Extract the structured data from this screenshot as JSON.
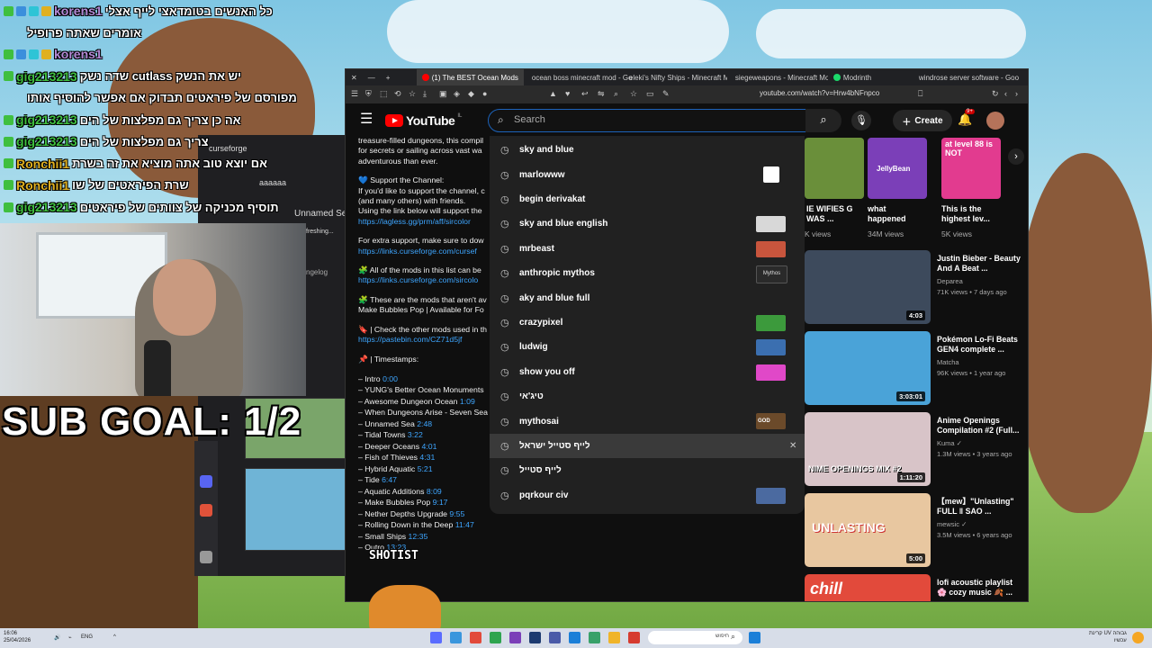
{
  "chat": [
    {
      "user": "korens1",
      "user_color": "#b48ad6",
      "msg": "כל האנשים בטומדאצי לייף אצלי"
    },
    {
      "user": "",
      "user_color": "",
      "msg": "אומרים שאתה פרופיל",
      "cont": true
    },
    {
      "user": "korens1",
      "user_color": "#b48ad6",
      "msg": ""
    },
    {
      "user": "gig213213",
      "user_color": "#3fbf3f",
      "msg": "שדה נשק cutlass יש את הנשק"
    },
    {
      "user": "",
      "user_color": "",
      "msg": "מפורסם של פיראטים תבדוק אם אפשר להוסיף אותו",
      "cont": true
    },
    {
      "user": "gig213213",
      "user_color": "#3fbf3f",
      "msg": "אה כן צריך גם מפלצות של הים"
    },
    {
      "user": "gig213213",
      "user_color": "#3fbf3f",
      "msg": "צריך גם מפלצות של הים"
    },
    {
      "user": "Ronchii1",
      "user_color": "#e0b020",
      "msg": "אם יוצא טוב אתה מוציא את זה בשרת"
    },
    {
      "user": "Ronchii1",
      "user_color": "#e0b020",
      "msg": "שרת הפיראטים של שו"
    },
    {
      "user": "gig213213",
      "user_color": "#3fbf3f",
      "msg": "תוסיף מכניקה של צוותים של פיראטים"
    }
  ],
  "overlay": {
    "sub_goal": "SUB GOAL: 1/2",
    "shotist": "SHOTIST"
  },
  "curseforge": {
    "title": "curseforge",
    "item1": "aaaaaa",
    "unnamed": "Unnamed Sea",
    "refreshing": "freshing...",
    "changelog": "ngelog"
  },
  "browser": {
    "tabs": [
      {
        "label": "(1) The BEST Ocean Mods",
        "active": true,
        "color": "#ff0000"
      },
      {
        "label": "ocean boss minecraft mod - Go",
        "active": false,
        "color": "#4285f4"
      },
      {
        "label": "eleki's Nifty Ships - Minecraft M",
        "active": false,
        "color": "#f16436"
      },
      {
        "label": "siegeweapons - Minecraft Mod",
        "active": false,
        "color": "#f16436"
      },
      {
        "label": "Modrinth",
        "active": false,
        "color": "#1bd96a"
      },
      {
        "label": "windrose server software - Goo",
        "active": false,
        "color": "#4285f4"
      }
    ],
    "url": "youtube.com/watch?v=Hrw4bNFnpco"
  },
  "youtube": {
    "logo": "YouTube",
    "country": "IL",
    "search_placeholder": "Search",
    "create_label": "Create",
    "notif_count": "9+"
  },
  "description": {
    "intro_1": "treasure-filled dungeons, this compil",
    "intro_2": "for secrets or sailing across vast wa",
    "intro_3": "adventurous than ever.",
    "support_head": "💙 Support the Channel:",
    "support_1": "If you'd like to support the channel, c",
    "support_2": "(and many others) with friends.",
    "support_3": "Using the link below will support the",
    "support_link": "https://lagless.gg/prm/aff/sircolor",
    "extra": "For extra support, make sure to dow",
    "extra_link": "https://links.curseforge.com/cursef",
    "all_mods": "🧩 All of the mods in this list can be",
    "all_mods_link": "https://links.curseforge.com/sircolo",
    "arent_1": "🧩 These are the mods that aren't av",
    "arent_2": "Make Bubbles Pop | Available for Fo",
    "check": "🔖 | Check the other mods used in th",
    "check_link": "https://pastebin.com/CZ71d5jf",
    "timestamps_head": "📌 | Timestamps:",
    "timestamps": [
      {
        "label": "– Intro",
        "time": "0:00"
      },
      {
        "label": "– YUNG's Better Ocean Monuments",
        "time": ""
      },
      {
        "label": "– Awesome Dungeon Ocean",
        "time": "1:09"
      },
      {
        "label": "– When Dungeons Arise - Seven Sea",
        "time": ""
      },
      {
        "label": "– Unnamed Sea",
        "time": "2:48"
      },
      {
        "label": "– Tidal Towns",
        "time": "3:22"
      },
      {
        "label": "– Deeper Oceans",
        "time": "4:01"
      },
      {
        "label": "– Fish of Thieves",
        "time": "4:31"
      },
      {
        "label": "– Hybrid Aquatic",
        "time": "5:21"
      },
      {
        "label": "– Tide",
        "time": "6:47"
      },
      {
        "label": "– Aquatic Additions",
        "time": "8:09"
      },
      {
        "label": "– Make Bubbles Pop",
        "time": "9:17"
      },
      {
        "label": "– Nether Depths Upgrade",
        "time": "9:55"
      },
      {
        "label": "– Rolling Down in the Deep",
        "time": "11:47"
      },
      {
        "label": "– Small Ships",
        "time": "12:35"
      },
      {
        "label": "– Outro",
        "time": "13:23"
      }
    ]
  },
  "search_history": [
    {
      "text": "sky and blue",
      "thumb": ""
    },
    {
      "text": "marlowww",
      "thumb": "#ffffff"
    },
    {
      "text": "begin derivakat",
      "thumb": ""
    },
    {
      "text": "sky and blue english",
      "thumb": "#d8d8d8"
    },
    {
      "text": "mrbeast",
      "thumb": "#c8553d"
    },
    {
      "text": "anthropic mythos",
      "thumb": "#2a2a2a",
      "thumb_text": "Mythos"
    },
    {
      "text": "aky and blue full",
      "thumb": ""
    },
    {
      "text": "crazypixel",
      "thumb": "#3c9a3c"
    },
    {
      "text": "ludwig",
      "thumb": "#3b6fb0"
    },
    {
      "text": "show you off",
      "thumb": "#e048c8"
    },
    {
      "text": "טיג'אי",
      "thumb": ""
    },
    {
      "text": "mythosai",
      "thumb": "#6b4a2a",
      "thumb_text": "GOD"
    },
    {
      "text": "לייף סטייל ישראל",
      "thumb": "",
      "hover": true,
      "remove": "✕"
    },
    {
      "text": "לייף סטייל",
      "thumb": ""
    },
    {
      "text": "pqrkour civ",
      "thumb": "#4b6aa0"
    }
  ],
  "shorts": [
    {
      "title": "IE WIFIES G WAS ...",
      "views": "K views",
      "color": "#6a8f3a"
    },
    {
      "title": "what happened",
      "views": "34M views",
      "color": "#7b3fb8",
      "overlay": "JellyBean"
    },
    {
      "title": "This is the highest lev...",
      "views": "5K views",
      "color": "#e23b8f",
      "overlay": "at level 88 is NOT"
    }
  ],
  "recommendations": [
    {
      "title": "Justin Bieber - Beauty And A Beat ...",
      "channel": "Deparea",
      "meta": "71K views • 7 days ago",
      "duration": "4:03",
      "color": "#3d4a5c"
    },
    {
      "title": "Pokémon Lo-Fi Beats GEN4 complete ...",
      "channel": "Matcha",
      "meta": "96K views • 1 year ago",
      "duration": "3:03:01",
      "color": "#4aa3d8"
    },
    {
      "title": "Anime Openings Compilation #2 (Full...",
      "channel": "Kuma ✓",
      "meta": "1.3M views • 3 years ago",
      "duration": "1:11:20",
      "color": "#d8c4c8",
      "overlay": "NIME OPENINGS MIX #2"
    },
    {
      "title": "【mew】\"Unlasting\" FULL ‖ SAO ...",
      "channel": "mewsic ✓",
      "meta": "3.5M views • 6 years ago",
      "duration": "5:00",
      "color": "#e8c7a0",
      "overlay": "UNLASTING"
    },
    {
      "title": "lofi acoustic playlist 🌸 cozy music 🍂 ...",
      "channel": "",
      "meta": "",
      "duration": "",
      "color": "#e24a3b",
      "overlay": "chill"
    }
  ],
  "taskbar": {
    "date": "25/04/2026",
    "time": "16:06",
    "lang": "ENG",
    "search": "חיפוש",
    "weather": "קרינת UV גבוהה",
    "weather_sub": "עכשיו"
  }
}
